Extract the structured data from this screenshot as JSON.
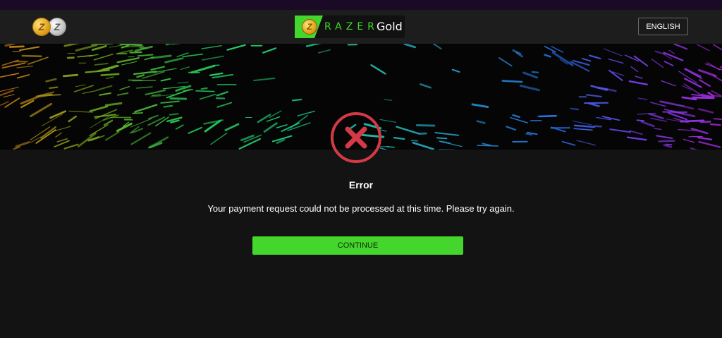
{
  "header": {
    "coins_icon": "razer-gold-silver-coins-icon",
    "logo": {
      "icon": "razer-gold-logo",
      "brand": "RAZER",
      "product": "Gold"
    },
    "language_button": "ENGLISH"
  },
  "banner": {
    "description_icon": "colorful-streaks-banner"
  },
  "error": {
    "icon": "error-x-circle-icon",
    "title": "Error",
    "message": "Your payment request could not be processed at this time. Please try again.",
    "button": "CONTINUE"
  },
  "colors": {
    "accent": "#44d62c",
    "error_red": "#d33a45",
    "background": "#131313",
    "header": "#1d1d1d"
  }
}
